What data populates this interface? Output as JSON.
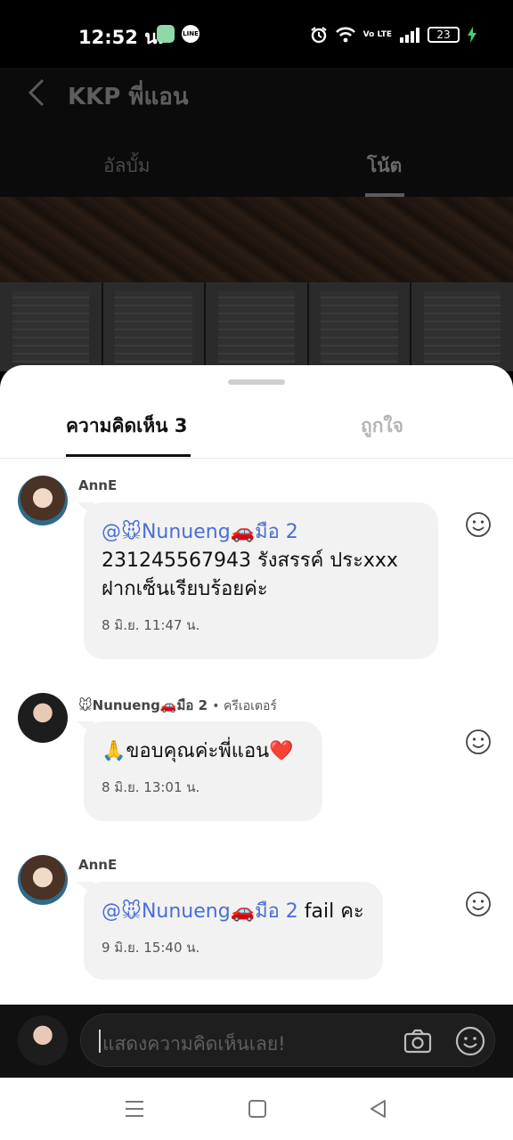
{
  "status_bar": {
    "time": "12:52 น.",
    "notif_1": "",
    "notif_2": "LINE",
    "network": "Vo LTE",
    "battery": "23"
  },
  "background_page": {
    "title": "KKP พี่แอน",
    "tabs": [
      "อัลบั้ม",
      "โน้ต"
    ],
    "active_tab": "โน้ต"
  },
  "sheet": {
    "tab_comments": "ความคิดเห็น 3",
    "tab_likes": "ถูกใจ"
  },
  "comments": [
    {
      "author": "AnnE",
      "mention": "@🐭Nunueng🚗มือ 2",
      "lines": [
        "231245567943 รังสรรค์ ประxxx",
        "ฝากเซ็นเรียบร้อยค่ะ"
      ],
      "time": "8 มิ.ย. 11:47 น."
    },
    {
      "author": "🐭Nunueng🚗มือ 2",
      "author_role": "• ครีเอเตอร์",
      "text": "🙏ขอบคุณค่ะพี่แอน❤️",
      "time": "8 มิ.ย. 13:01 น."
    },
    {
      "author": "AnnE",
      "mention": "@🐭Nunueng🚗มือ 2",
      "text_after": " fail คะ",
      "time": "9 มิ.ย. 15:40 น."
    }
  ],
  "input": {
    "placeholder": "แสดงความคิดเห็นเลย!"
  },
  "colors": {
    "mention": "#4a6fd6",
    "bubble": "#f2f2f2"
  }
}
